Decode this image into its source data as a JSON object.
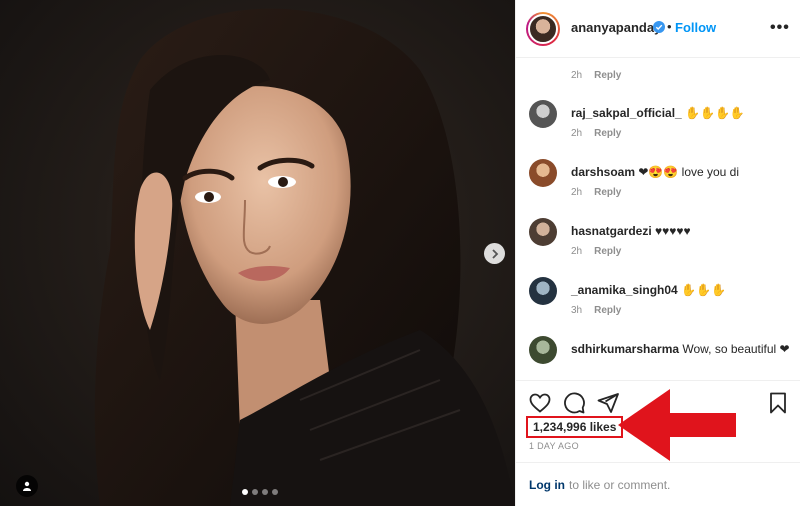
{
  "header": {
    "username": "ananyapanday",
    "separator": "•",
    "follow_label": "Follow",
    "more_label": "•••"
  },
  "comments": [
    {
      "username": "",
      "text": "",
      "time": "2h",
      "reply": "Reply"
    },
    {
      "username": "raj_sakpal_official_",
      "text": "✋✋✋✋",
      "time": "2h",
      "reply": "Reply",
      "avatar_color": "#4a4a4a"
    },
    {
      "username": "darshsoam",
      "text": "❤😍😍 love you di",
      "time": "2h",
      "reply": "Reply",
      "avatar_color": "#a8643c"
    },
    {
      "username": "hasnatgardezi",
      "text": "♥♥♥♥♥",
      "time": "2h",
      "reply": "Reply",
      "avatar_color": "#7d6a5c"
    },
    {
      "username": "_anamika_singh04",
      "text": "✋✋✋",
      "time": "3h",
      "reply": "Reply",
      "avatar_color": "#2f3c4a"
    },
    {
      "username": "sdhirkumarsharma",
      "text": "Wow, so beautiful ❤",
      "time": "",
      "reply": "",
      "avatar_color": "#4a5c3c"
    }
  ],
  "actions": {
    "likes": "1,234,996 likes",
    "time_ago": "1 DAY AGO",
    "like_icon": "heart-icon",
    "comment_icon": "comment-icon",
    "share_icon": "share-icon",
    "save_icon": "bookmark-icon"
  },
  "login": {
    "link": "Log in",
    "text": "to like or comment."
  },
  "colors": {
    "accent": "#0095f6",
    "annotation": "#e0141c"
  }
}
